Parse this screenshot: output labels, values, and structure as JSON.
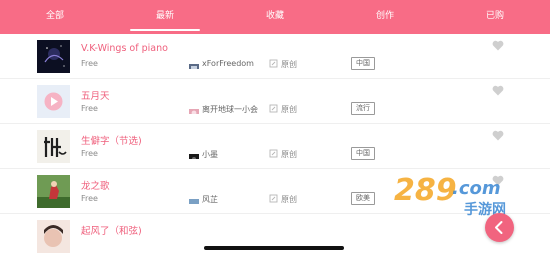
{
  "tabs": [
    {
      "label": "全部"
    },
    {
      "label": "最新"
    },
    {
      "label": "收藏"
    },
    {
      "label": "创作"
    },
    {
      "label": "已购"
    }
  ],
  "active_tab": "最新",
  "songs": [
    {
      "title": "V.K-Wings of piano",
      "price": "Free",
      "author": "xForFreedom",
      "original_label": "原创",
      "tags": [
        "中国"
      ]
    },
    {
      "title": "五月天",
      "price": "Free",
      "author": "离开地球一小会",
      "original_label": "原创",
      "tags": [
        "流行"
      ]
    },
    {
      "title": "生僻字（节选)",
      "price": "Free",
      "author": "小墨",
      "original_label": "原创",
      "tags": [
        "中国"
      ]
    },
    {
      "title": "龙之歌",
      "price": "Free",
      "author": "风芷",
      "original_label": "原创",
      "tags": [
        "欧美"
      ]
    },
    {
      "title": "起风了（和弦)",
      "price": "",
      "author": "",
      "original_label": "",
      "tags": []
    }
  ],
  "watermark": {
    "line1": "289.com",
    "line2": "手游网"
  },
  "icons": {
    "favorite": "heart-icon",
    "back": "chevron-left-icon",
    "original": "document-icon"
  },
  "colors": {
    "accent": "#f86c86",
    "title": "#ef5f7c",
    "heart": "#cfcfcf"
  }
}
